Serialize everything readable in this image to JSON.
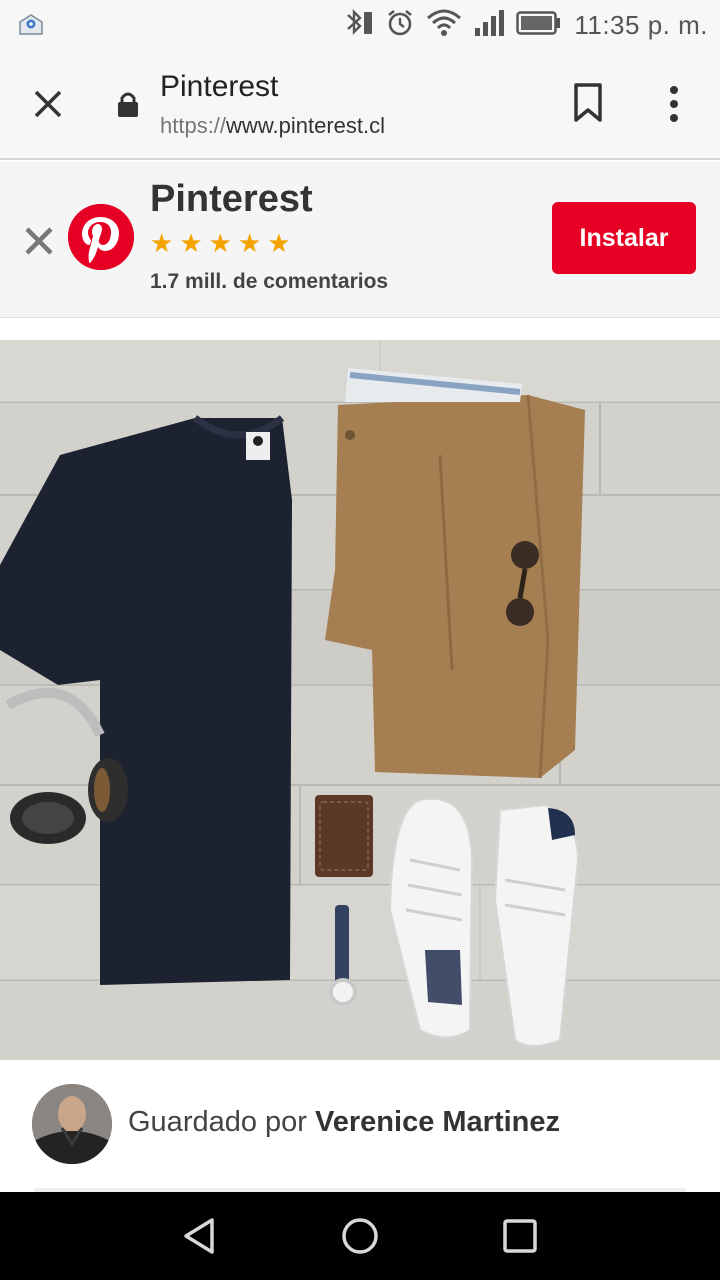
{
  "status_bar": {
    "time": "11:35 p. m.",
    "icons": [
      "email-notification-icon",
      "bluetooth-icon",
      "alarm-icon",
      "wifi-icon",
      "signal-icon",
      "battery-icon"
    ]
  },
  "toolbar": {
    "title": "Pinterest",
    "url_scheme": "https://",
    "url_host": "www.pinterest.cl",
    "icons": [
      "close-icon",
      "lock-icon",
      "bookmark-icon",
      "more-vert-icon"
    ]
  },
  "banner": {
    "app_name": "Pinterest",
    "rating_stars": 5,
    "reviews": "1.7 mill. de comentarios",
    "install_label": "Instalar",
    "brand_color": "#e60023",
    "star_color": "#f5a300"
  },
  "pin": {
    "image_subject": "flat-lay outfit photo"
  },
  "saved": {
    "prefix": "Guardado por ",
    "name": "Verenice Martinez"
  },
  "nav_bar": {
    "icons": [
      "back-icon",
      "home-icon",
      "recents-icon"
    ]
  }
}
